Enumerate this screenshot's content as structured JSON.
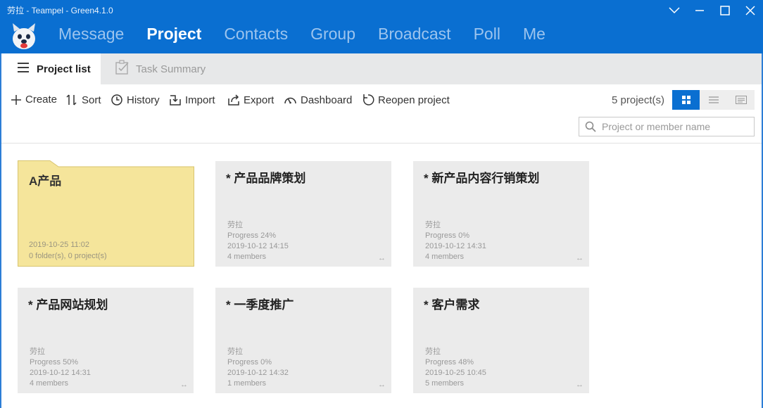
{
  "window": {
    "title": "劳拉 - Teampel - Green4.1.0"
  },
  "nav": {
    "items": [
      {
        "label": "Message",
        "active": false
      },
      {
        "label": "Project",
        "active": true
      },
      {
        "label": "Contacts",
        "active": false
      },
      {
        "label": "Group",
        "active": false
      },
      {
        "label": "Broadcast",
        "active": false
      },
      {
        "label": "Poll",
        "active": false
      },
      {
        "label": "Me",
        "active": false
      }
    ]
  },
  "tabs": {
    "project_list": "Project list",
    "task_summary": "Task Summary"
  },
  "toolbar": {
    "create": "Create",
    "sort": "Sort",
    "history": "History",
    "import": "Import",
    "export": "Export",
    "dashboard": "Dashboard",
    "reopen": "Reopen project",
    "count": "5 project(s)"
  },
  "search": {
    "placeholder": "Project or member name",
    "value": ""
  },
  "folder": {
    "title": "A产品",
    "date": "2019-10-25 11:02",
    "summary": "0 folder(s), 0 project(s)"
  },
  "projects": [
    {
      "title": "* 产品品牌策划",
      "owner": "劳拉",
      "progress": "Progress 24%",
      "date": "2019-10-12 14:15",
      "members": "4 members"
    },
    {
      "title": "* 新产品内容行销策划",
      "owner": "劳拉",
      "progress": "Progress 0%",
      "date": "2019-10-12 14:31",
      "members": "4 members"
    },
    {
      "title": "* 产品网站规划",
      "owner": "劳拉",
      "progress": "Progress 50%",
      "date": "2019-10-12 14:31",
      "members": "4 members"
    },
    {
      "title": "* 一季度推广",
      "owner": "劳拉",
      "progress": "Progress 0%",
      "date": "2019-10-12 14:32",
      "members": "1 members"
    },
    {
      "title": "* 客户需求",
      "owner": "劳拉",
      "progress": "Progress 48%",
      "date": "2019-10-25 10:45",
      "members": "5 members"
    }
  ],
  "card_arrow": "↔",
  "colors": {
    "accent": "#0a6fd1",
    "folder": "#f5e59b",
    "card": "#ebebeb"
  }
}
